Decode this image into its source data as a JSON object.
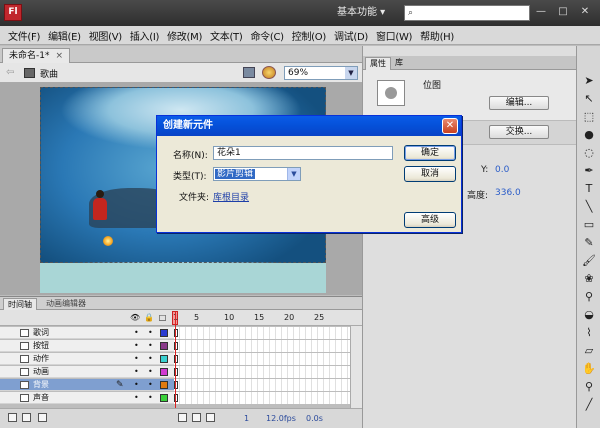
{
  "app": {
    "logo": "Fl",
    "workspace": "基本功能 ▾",
    "search_placeholder": "",
    "win": {
      "min": "—",
      "max": "□",
      "close": "✕"
    }
  },
  "menu": [
    "文件(F)",
    "编辑(E)",
    "视图(V)",
    "插入(I)",
    "修改(M)",
    "文本(T)",
    "命令(C)",
    "控制(O)",
    "调试(D)",
    "窗口(W)",
    "帮助(H)"
  ],
  "document": {
    "tab": "未命名-1*",
    "tab_close": "×",
    "scene": "歌曲",
    "zoom": "69%"
  },
  "timeline": {
    "tabs": [
      "时间轴",
      "动画编辑器"
    ],
    "header_icons": {
      "eye": "👁",
      "lock": "🔒",
      "outline": "□"
    },
    "frame_numbers": [
      "1",
      "5",
      "10",
      "15",
      "20",
      "25"
    ],
    "layers": [
      {
        "name": "歌词",
        "color": "#2a3bd0",
        "selected": false
      },
      {
        "name": "按钮",
        "color": "#8a3a8a",
        "selected": false
      },
      {
        "name": "动作",
        "color": "#3ad0d0",
        "selected": false
      },
      {
        "name": "动画",
        "color": "#d03ad0",
        "selected": false
      },
      {
        "name": "背景",
        "color": "#e07a10",
        "selected": true
      },
      {
        "name": "声音",
        "color": "#3ad03a",
        "selected": false
      }
    ],
    "footer": {
      "frame": "1",
      "fps": "12.0fps",
      "time": "0.0s"
    }
  },
  "properties": {
    "tabs": [
      "属性",
      "库"
    ],
    "type": "位图",
    "edit_button": "编辑...",
    "swap_button": "交换...",
    "y_label": "Y:",
    "y_value": "0.0",
    "h_label": "高度:",
    "h_value": "336.0"
  },
  "dialog": {
    "title": "创建新元件",
    "close": "✕",
    "name_label": "名称(N):",
    "name_value": "花朵1",
    "type_label": "类型(T):",
    "type_value": "影片剪辑",
    "folder_label": "文件夹:",
    "folder_link": "库根目录",
    "ok": "确定",
    "cancel": "取消",
    "advanced": "高级"
  }
}
